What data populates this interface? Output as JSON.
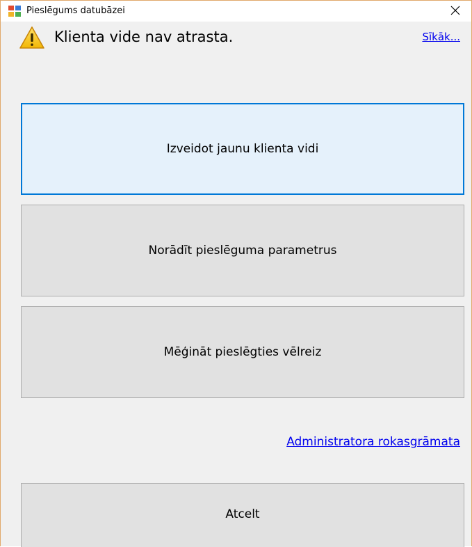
{
  "window": {
    "title": "Pieslēgums datubāzei",
    "close_glyph": "✕"
  },
  "header": {
    "message": "Klienta vide nav atrasta.",
    "icon": "warning-icon",
    "more_link": "Sīkāk..."
  },
  "actions": {
    "create_env": "Izveidot jaunu klienta vidi",
    "set_params": "Norādīt pieslēguma parametrus",
    "retry": "Mēģināt pieslēgties vēlreiz"
  },
  "admin_link": "Administratora rokasgrāmata",
  "cancel_label": "Atcelt",
  "colors": {
    "accent": "#0078d7",
    "link": "#0000ee",
    "button_bg": "#e1e1e1",
    "dialog_bg": "#f0f0f0",
    "window_border": "#e0a86a"
  }
}
